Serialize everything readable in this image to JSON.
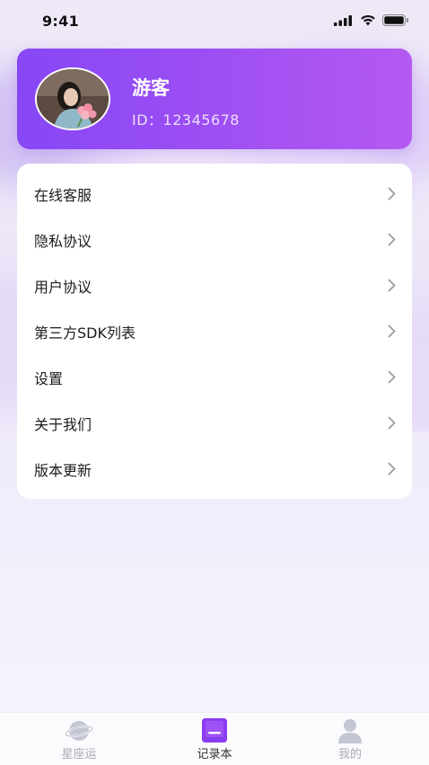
{
  "status_bar": {
    "time": "9:41"
  },
  "profile": {
    "name": "游客",
    "id_text": "ID：12345678"
  },
  "menu": {
    "items": [
      {
        "label": "在线客服"
      },
      {
        "label": "隐私协议"
      },
      {
        "label": "用户协议"
      },
      {
        "label": "第三方SDK列表"
      },
      {
        "label": "设置"
      },
      {
        "label": "关于我们"
      },
      {
        "label": "版本更新"
      }
    ]
  },
  "tabbar": {
    "tabs": [
      {
        "label": "星座运",
        "icon": "planet-icon",
        "active": false
      },
      {
        "label": "记录本",
        "icon": "notebook-icon",
        "active": true
      },
      {
        "label": "我的",
        "icon": "person-icon",
        "active": false
      }
    ]
  },
  "colors": {
    "accent_start": "#8747f5",
    "accent_end": "#b559f1",
    "active_tab_icon": "#8a3cf0"
  }
}
